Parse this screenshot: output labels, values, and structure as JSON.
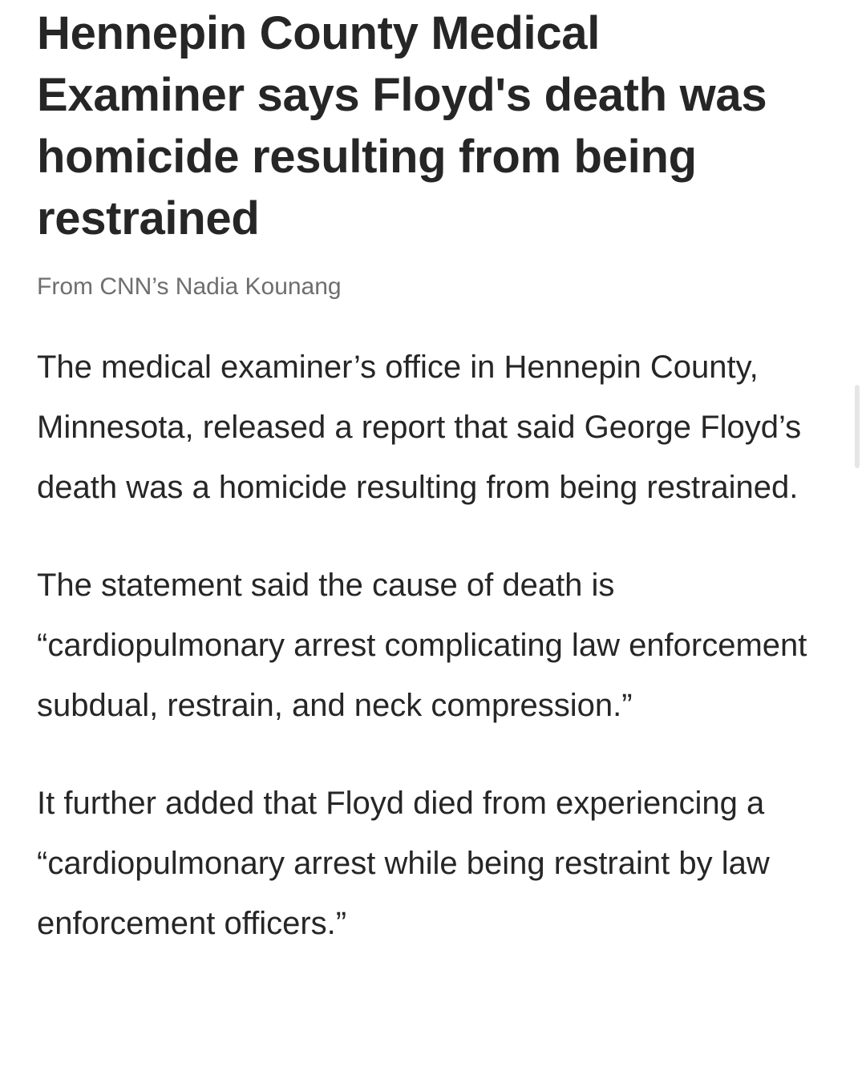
{
  "article": {
    "headline": "Hennepin County Medical Examiner says Floyd's death was homicide resulting from being restrained",
    "byline": "From CNN’s Nadia Kounang",
    "paragraphs": [
      "The medical examiner’s office in Hennepin County, Minnesota, released a report that said George Floyd’s death was a homicide resulting from being restrained.",
      "The statement said the cause of death is “cardiopulmonary arrest complicating law enforcement subdual, restrain, and neck compression.”",
      "It further added that Floyd died from experiencing a “cardiopulmonary arrest while being restraint by law enforcement officers.”"
    ]
  }
}
